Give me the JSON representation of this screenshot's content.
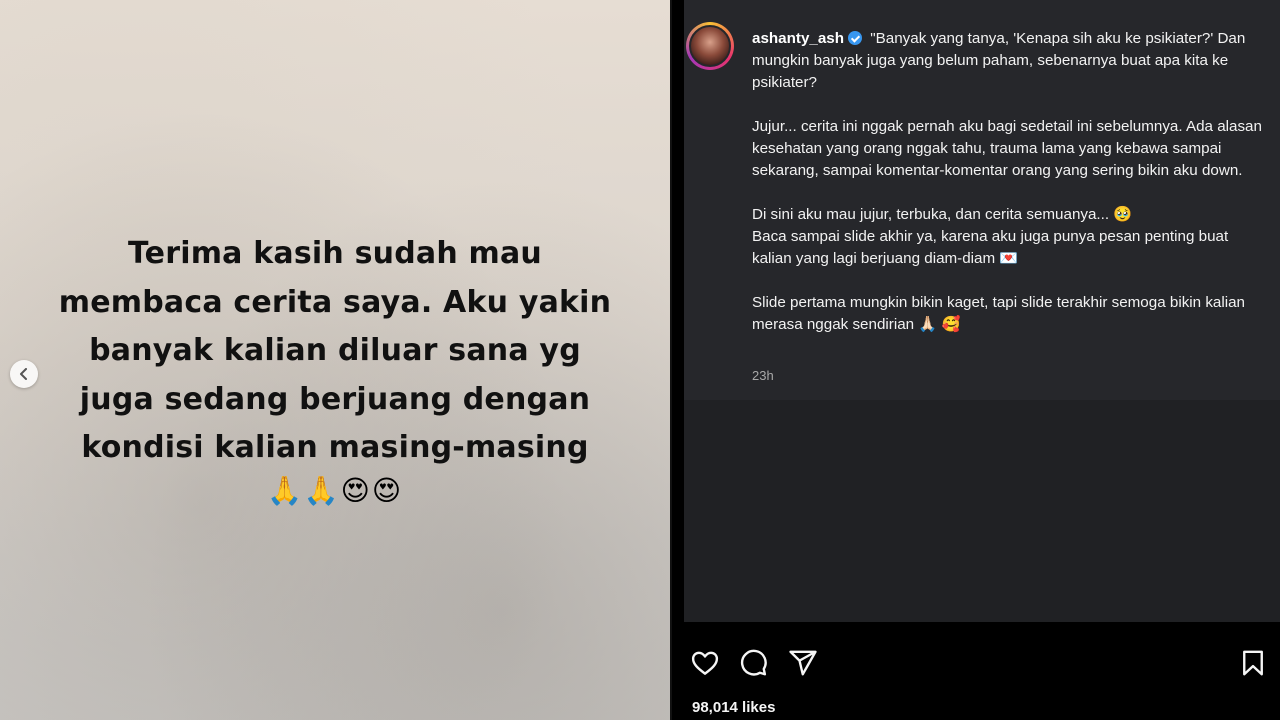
{
  "media": {
    "text": "Terima kasih sudah mau membaca cerita saya. Aku yakin banyak kalian diluar sana yg juga sedang berjuang dengan kondisi kalian masing-masing",
    "emoji": "🙏🙏😍😍",
    "prev_icon": "chevron-left-icon"
  },
  "post": {
    "username": "ashanty_ash",
    "verified": true,
    "caption": {
      "p1": "\"Banyak yang tanya, 'Kenapa sih aku ke psikiater?' Dan mungkin banyak juga yang belum paham, sebenarnya buat apa kita ke psikiater?",
      "p2": "Jujur... cerita ini nggak pernah aku bagi sedetail ini sebelumnya. Ada alasan kesehatan yang orang nggak tahu, trauma lama yang kebawa sampai sekarang, sampai komentar-komentar orang yang sering bikin aku down.",
      "p3a": "Di sini aku mau jujur, terbuka, dan cerita semuanya... 🥹",
      "p3b": "Baca sampai slide akhir ya, karena aku juga punya pesan penting buat kalian yang lagi berjuang diam-diam 💌",
      "p4": "Slide pertama mungkin bikin kaget, tapi slide terakhir semoga bikin kalian merasa nggak sendirian 🙏🏻 🥰"
    },
    "timestamp": "23h",
    "likes": "98,014 likes"
  },
  "actions": {
    "like_icon": "heart-icon",
    "comment_icon": "comment-icon",
    "share_icon": "share-icon",
    "save_icon": "bookmark-icon"
  },
  "colors": {
    "panel": "#26272b",
    "verified": "#3897f0",
    "text": "#f2f2f2",
    "muted": "#a8a8a8"
  }
}
